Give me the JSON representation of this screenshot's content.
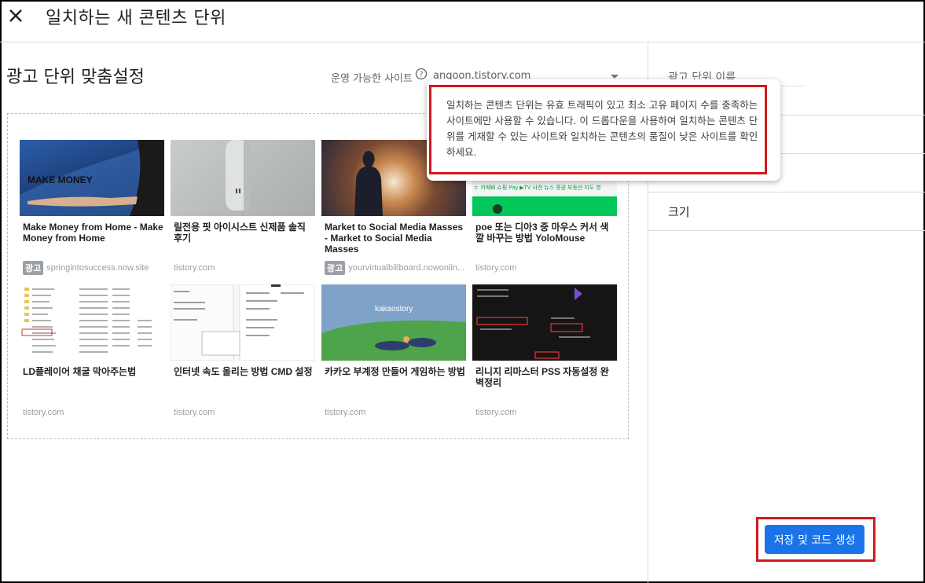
{
  "header": {
    "title": "일치하는 새 콘텐츠 단위"
  },
  "left": {
    "section_title": "광고 단위 맞춤설정",
    "site_label": "운영 가능한 사이트",
    "site_value": "angoon.tistory.com"
  },
  "cards": [
    {
      "title": "Make Money from Home - Make Money from Home",
      "source": "springintosuccess.now.site",
      "ad": true,
      "thumb_text": "MAKE MONEY"
    },
    {
      "title": "릴전용 핏 아이시스트 신제품 솔직 후기",
      "source": "tistory.com",
      "ad": false,
      "thumb_text": ""
    },
    {
      "title": "Market to Social Media Masses - Market to Social Media Masses",
      "source": "yourvirtualbillboard.nowonlin...",
      "ad": true,
      "thumb_text": ""
    },
    {
      "title": "poe 또는 디아3 중 마우스 커서 색깔 바꾸는 방법 YoloMouse",
      "source": "tistory.com",
      "ad": false,
      "thumb_text": "ㄷ 카페Bl 쇼핑 Pay ▶TV 사전 뉴스 증권 부동산 지도 영"
    },
    {
      "title": "LD플레이어 채굴 막아주는법",
      "source": "tistory.com",
      "ad": false,
      "thumb_text": ""
    },
    {
      "title": "인터넷 속도 올리는 방법 CMD 설정",
      "source": "tistory.com",
      "ad": false,
      "thumb_text": ""
    },
    {
      "title": "카카오 부계정 만들어 게임하는 방법",
      "source": "tistory.com",
      "ad": false,
      "thumb_text": "kakaostory"
    },
    {
      "title": "리니지 리마스터 PSS 자동설정 완벽정리",
      "source": "tistory.com",
      "ad": false,
      "thumb_text": ""
    }
  ],
  "ad_badge": "광고",
  "right": {
    "name_label": "광고 단위 이름",
    "size_label": "크기",
    "save_label": "저장 및 코드 생성"
  },
  "tooltip": {
    "text": "일치하는 콘텐츠 단위는 유효 트래픽이 있고 최소 고유 페이지 수를 충족하는 사이트에만 사용할 수 있습니다. 이 드롭다운을 사용하여 일치하는 콘텐츠 단위를 게재할 수 있는 사이트와 일치하는 콘텐츠의 품질이 낮은 사이트를 확인하세요."
  },
  "colors": {
    "primary": "#1a73e8",
    "highlight": "#d0191f",
    "muted": "#9aa0a6"
  }
}
